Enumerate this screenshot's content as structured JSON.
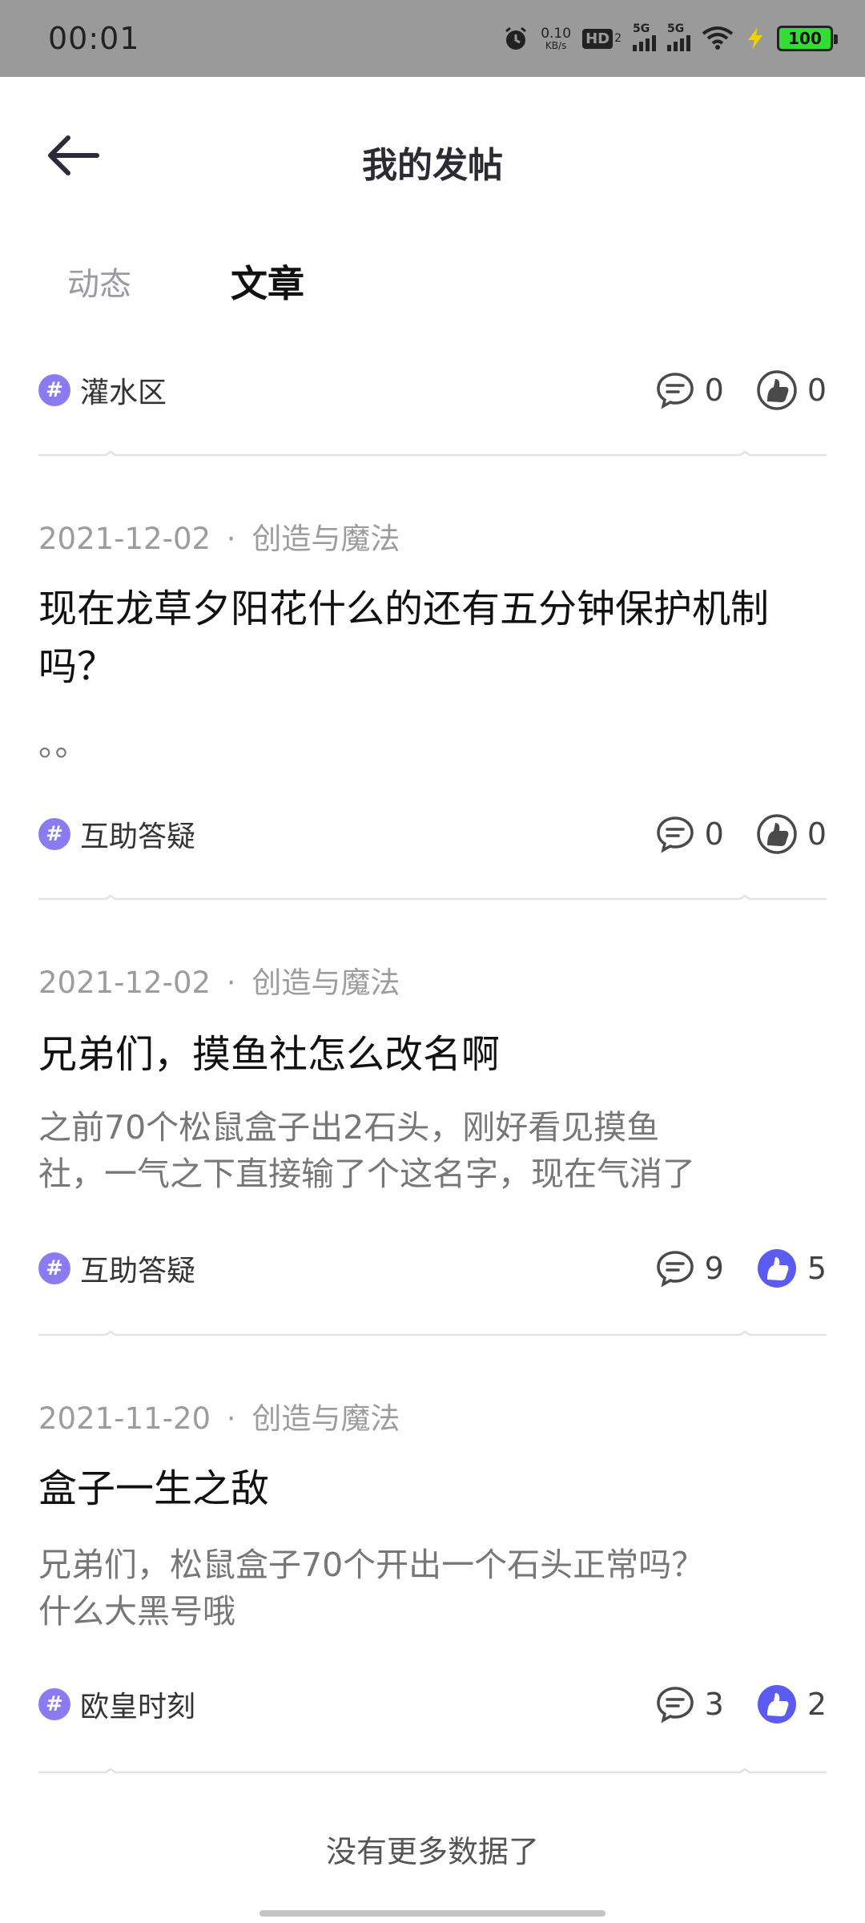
{
  "status_bar": {
    "time": "00:01",
    "net_speed_value": "0.10",
    "net_speed_unit": "KB/s",
    "hd_label": "HD",
    "hd_sub": "2",
    "sim1_label": "5G",
    "sim2_label": "5G",
    "battery_level": "100",
    "battery_color": "#33dd33"
  },
  "nav": {
    "title": "我的发帖",
    "back_icon": "arrow-left-icon"
  },
  "tabs": {
    "dynamic": "动态",
    "article": "文章",
    "active": "文章"
  },
  "posts": [
    {
      "topic": "灌水区",
      "comments": "0",
      "likes": "0",
      "liked": false
    },
    {
      "date": "2021-12-02",
      "separator": "·",
      "board": "创造与魔法",
      "title": "现在龙草夕阳花什么的还有五分钟保护机制吗？",
      "excerpt": "。。",
      "topic": "互助答疑",
      "comments": "0",
      "likes": "0",
      "liked": false
    },
    {
      "date": "2021-12-02",
      "separator": "·",
      "board": "创造与魔法",
      "title": "兄弟们，摸鱼社怎么改名啊",
      "excerpt_line1": "之前70个松鼠盒子出2石头，刚好看见摸鱼",
      "excerpt_line2": "社，一气之下直接输了个这名字，现在气消了",
      "topic": "互助答疑",
      "comments": "9",
      "likes": "5",
      "liked": true
    },
    {
      "date": "2021-11-20",
      "separator": "·",
      "board": "创造与魔法",
      "title": "盒子一生之敌",
      "excerpt_line1": "兄弟们，松鼠盒子70个开出一个石头正常吗？",
      "excerpt_line2": "什么大黑号哦",
      "topic": "欧皇时刻",
      "comments": "3",
      "likes": "2",
      "liked": true
    }
  ],
  "footer": {
    "no_more": "没有更多数据了"
  },
  "colors": {
    "accent_purple": "#8a7cf0",
    "like_active_blue": "#5b5bf0",
    "icon_dark": "#4a4a4a"
  }
}
